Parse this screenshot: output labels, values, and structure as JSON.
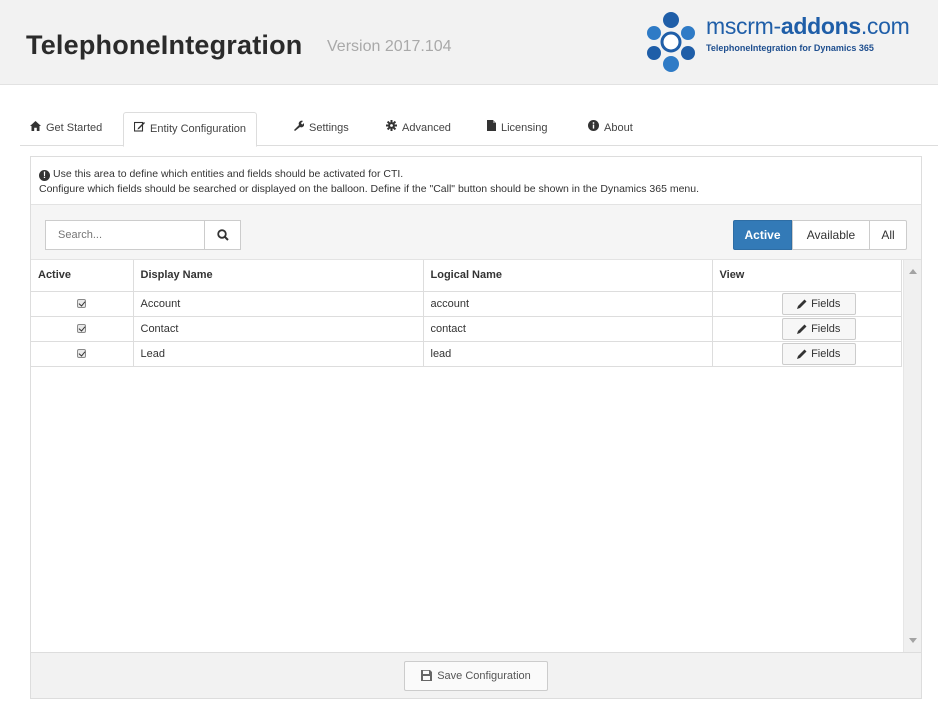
{
  "header": {
    "title": "TelephoneIntegration",
    "version": "Version 2017.104",
    "logo": {
      "name_prefix": "mscrm-",
      "name_bold": "addons",
      "name_suffix": ".com",
      "tagline": "TelephoneIntegration for Dynamics 365",
      "color": "#1f5ea8"
    }
  },
  "tabs": [
    {
      "label": "Get Started",
      "icon": "home-icon"
    },
    {
      "label": "Entity Configuration",
      "icon": "edit-icon",
      "active": true
    },
    {
      "label": "Settings",
      "icon": "wrench-icon"
    },
    {
      "label": "Advanced",
      "icon": "gear-icon"
    },
    {
      "label": "Licensing",
      "icon": "document-icon"
    },
    {
      "label": "About",
      "icon": "info-icon"
    }
  ],
  "info": {
    "line1": "Use this area to define which entities and fields should be activated for CTI.",
    "line2": "Configure which fields should be searched or displayed on the balloon. Define if the \"Call\" button should be shown in the Dynamics 365 menu."
  },
  "search": {
    "placeholder": "Search...",
    "value": ""
  },
  "filters": [
    {
      "label": "Active",
      "selected": true
    },
    {
      "label": "Available",
      "selected": false
    },
    {
      "label": "All",
      "selected": false
    }
  ],
  "table": {
    "columns": [
      "Active",
      "Display Name",
      "Logical Name",
      "View"
    ],
    "rows": [
      {
        "active": true,
        "display_name": "Account",
        "logical_name": "account",
        "view_label": "Fields"
      },
      {
        "active": true,
        "display_name": "Contact",
        "logical_name": "contact",
        "view_label": "Fields"
      },
      {
        "active": true,
        "display_name": "Lead",
        "logical_name": "lead",
        "view_label": "Fields"
      }
    ]
  },
  "footer": {
    "save_label": "Save Configuration"
  },
  "colors": {
    "accent": "#337ab7",
    "brand": "#1f5ea8"
  }
}
